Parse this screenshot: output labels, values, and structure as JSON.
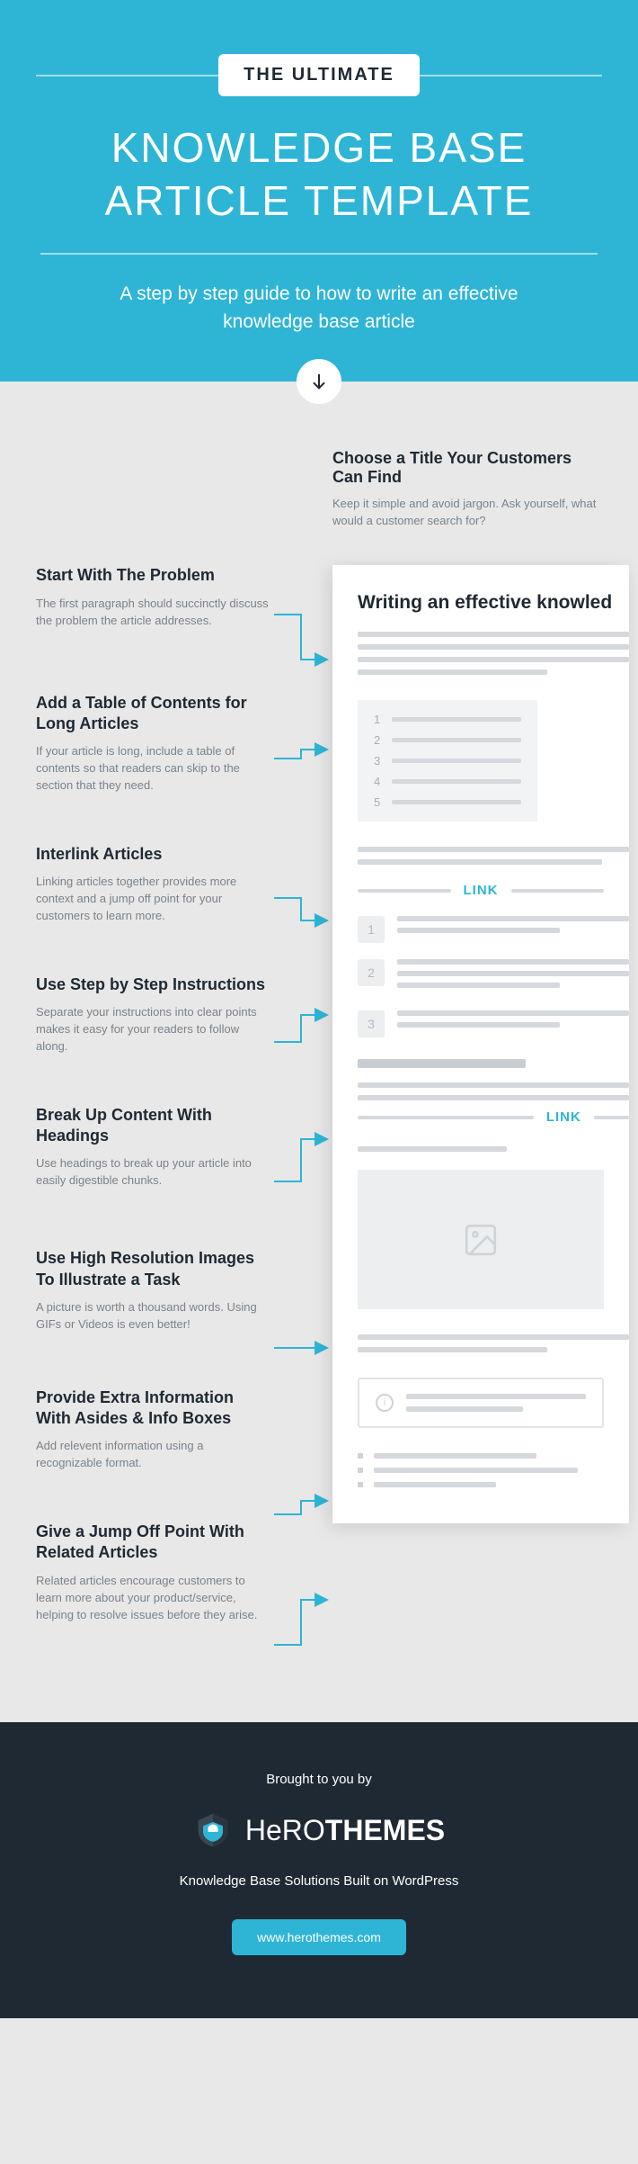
{
  "header": {
    "badge": "THE ULTIMATE",
    "title_line1": "KNOWLEDGE BASE",
    "title_line2": "ARTICLE TEMPLATE",
    "subtitle": "A step by step guide to how to write an effective knowledge base article"
  },
  "top_step": {
    "title": "Choose a Title Your Customers Can Find",
    "body": "Keep it simple and avoid jargon. Ask yourself, what would a customer search for?"
  },
  "steps": [
    {
      "title": "Start With The Problem",
      "body": "The first paragraph should succinctly discuss the problem the article addresses."
    },
    {
      "title": "Add a Table of Contents for Long Articles",
      "body": "If your article is long, include a table of contents so that readers can skip to the section that they need."
    },
    {
      "title": "Interlink Articles",
      "body": "Linking articles together provides more context and a jump off point for your customers to learn more."
    },
    {
      "title": "Use Step by Step Instructions",
      "body": "Separate your instructions into clear points makes it easy for your readers to follow along."
    },
    {
      "title": "Break Up Content With Headings",
      "body": "Use headings to break up your article into easily digestible chunks."
    },
    {
      "title": "Use High Resolution Images To Illustrate a Task",
      "body": "A picture is worth a thousand words. Using GIFs or Videos is even better!"
    },
    {
      "title": "Provide Extra Information With Asides & Info Boxes",
      "body": "Add relevent information using a recognizable format."
    },
    {
      "title": "Give a Jump Off Point With Related Articles",
      "body": "Related articles encourage customers to learn more about your product/service, helping to resolve issues before they arise."
    }
  ],
  "mock": {
    "title": "Writing an effective knowled",
    "toc": [
      "1",
      "2",
      "3",
      "4",
      "5"
    ],
    "link_label": "LINK",
    "steps": [
      "1",
      "2",
      "3"
    ]
  },
  "footer": {
    "by": "Brought to you by",
    "brand_thin": "HeRO",
    "brand_bold": "THEMES",
    "tagline": "Knowledge Base Solutions Built on WordPress",
    "url": "www.herothemes.com"
  }
}
